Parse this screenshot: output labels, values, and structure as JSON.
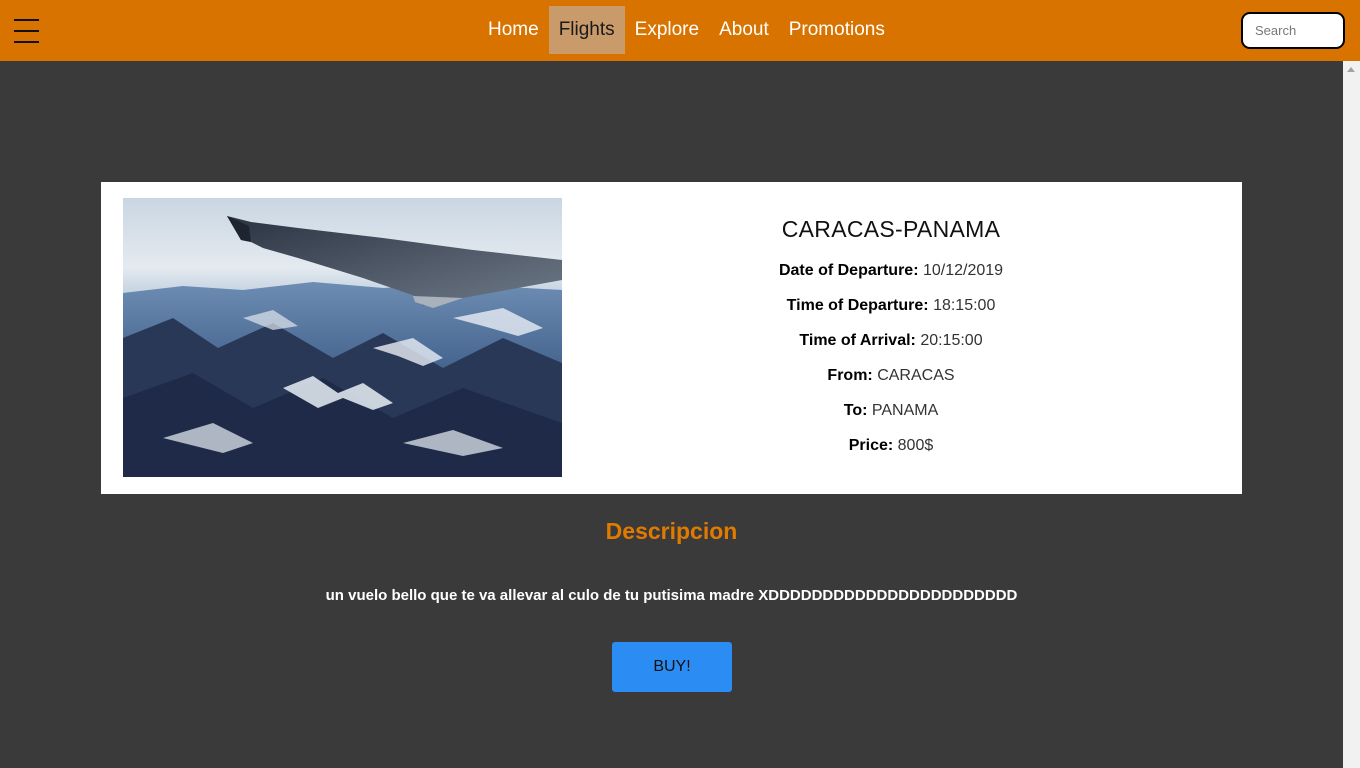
{
  "nav": {
    "items": [
      {
        "label": "Home",
        "active": false
      },
      {
        "label": "Flights",
        "active": true
      },
      {
        "label": "Explore",
        "active": false
      },
      {
        "label": "About",
        "active": false
      },
      {
        "label": "Promotions",
        "active": false
      }
    ],
    "search_placeholder": "Search",
    "menu_icon": "hamburger-menu-icon"
  },
  "flight": {
    "title": "CARACAS-PANAMA",
    "image_alt": "airplane-wing-over-snowy-mountains",
    "details": [
      {
        "label": "Date of Departure:",
        "value": "10/12/2019"
      },
      {
        "label": "Time of Departure:",
        "value": "18:15:00"
      },
      {
        "label": "Time of Arrival:",
        "value": "20:15:00"
      },
      {
        "label": "From:",
        "value": "CARACAS"
      },
      {
        "label": "To:",
        "value": "PANAMA"
      },
      {
        "label": "Price:",
        "value": "800$"
      }
    ]
  },
  "description": {
    "title": "Descripcion",
    "text": "un vuelo bello que te va allevar al culo de tu putisima madre XDDDDDDDDDDDDDDDDDDDDDDD"
  },
  "buy_label": "BUY!",
  "colors": {
    "navbar": "#d97300",
    "active_nav": "#c99a6a",
    "background": "#3a3a3a",
    "accent_text": "#e07a00",
    "buy_button": "#2b8cf3"
  }
}
